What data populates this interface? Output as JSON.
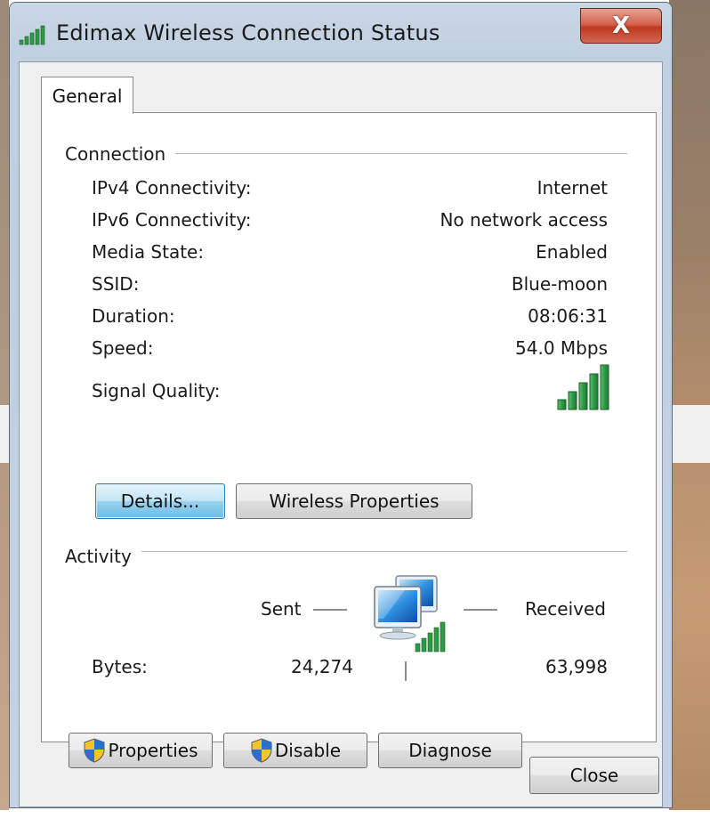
{
  "window": {
    "title": "Edimax Wireless Connection Status",
    "close_symbol": "X"
  },
  "tabs": [
    {
      "label": "General",
      "selected": true
    }
  ],
  "connection": {
    "group_label": "Connection",
    "rows": [
      {
        "label": "IPv4 Connectivity:",
        "value": "Internet"
      },
      {
        "label": "IPv6 Connectivity:",
        "value": "No network access"
      },
      {
        "label": "Media State:",
        "value": "Enabled"
      },
      {
        "label": "SSID:",
        "value": "Blue-moon"
      },
      {
        "label": "Duration:",
        "value": "08:06:31"
      },
      {
        "label": "Speed:",
        "value": "54.0 Mbps"
      }
    ],
    "signal_label": "Signal Quality:",
    "signal_bars_lit": 5,
    "signal_bars_total": 5,
    "details_button": "Details...",
    "wireless_properties_button": "Wireless Properties"
  },
  "activity": {
    "group_label": "Activity",
    "sent_label": "Sent",
    "received_label": "Received",
    "bytes_label": "Bytes:",
    "bytes_sent": "24,274",
    "bytes_received": "63,998"
  },
  "actions": {
    "properties_button": "Properties",
    "disable_button": "Disable",
    "diagnose_button": "Diagnose"
  },
  "footer": {
    "close_button": "Close"
  },
  "icons": {
    "title": "wireless-signal-icon",
    "network": "network-computers-icon",
    "signal": "signal-strength-icon",
    "uac": "uac-shield-icon"
  },
  "colors": {
    "signal_green": "#2e9a45",
    "titlebar": "#c4d2e2",
    "close_red": "#c8422a",
    "default_button": "#9ad3f0"
  }
}
